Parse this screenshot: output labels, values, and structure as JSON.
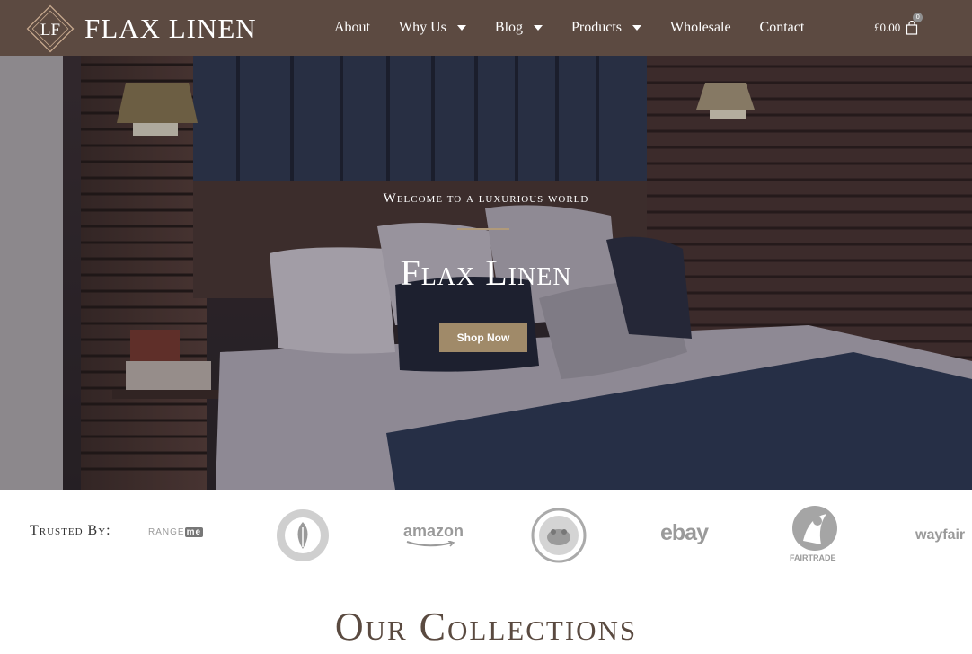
{
  "header": {
    "logo_text": "FLAX LINEN",
    "nav": [
      {
        "label": "About",
        "has_dropdown": false
      },
      {
        "label": "Why Us",
        "has_dropdown": true
      },
      {
        "label": "Blog",
        "has_dropdown": true
      },
      {
        "label": "Products",
        "has_dropdown": true
      },
      {
        "label": "Wholesale",
        "has_dropdown": false
      },
      {
        "label": "Contact",
        "has_dropdown": false
      }
    ],
    "cart": {
      "amount": "£0.00",
      "count": "0",
      "icon": "shopping-bag-icon"
    }
  },
  "hero": {
    "subtitle": "Welcome to a luxurious world",
    "title": "Flax Linen",
    "button_label": "Shop Now"
  },
  "trusted": {
    "label": "Trusted By:",
    "brands": {
      "rangeme": "RANGE",
      "rangeme_me": "me",
      "amazon": "amazon",
      "ebay": "ebay",
      "fairtrade": "FAIRTRADE",
      "wayfair": "wayfair"
    }
  },
  "collections": {
    "title": "Our Collections"
  },
  "colors": {
    "header_bg": "#5c4a41",
    "accent": "#a08a69",
    "title": "#5a4a40"
  }
}
